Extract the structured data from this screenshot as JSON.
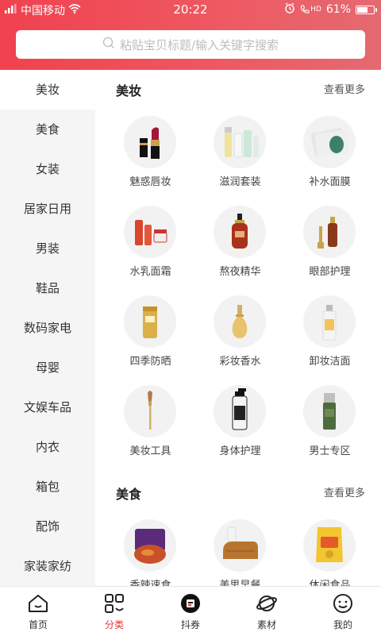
{
  "status_bar": {
    "carrier": "中国移动",
    "time": "20:22",
    "signal_text": "HD",
    "battery": "61%"
  },
  "search": {
    "placeholder": "粘贴宝贝标题/输入关键字搜索"
  },
  "sidebar": {
    "items": [
      {
        "label": "美妆"
      },
      {
        "label": "美食"
      },
      {
        "label": "女装"
      },
      {
        "label": "居家日用"
      },
      {
        "label": "男装"
      },
      {
        "label": "鞋品"
      },
      {
        "label": "数码家电"
      },
      {
        "label": "母婴"
      },
      {
        "label": "文娱车品"
      },
      {
        "label": "内衣"
      },
      {
        "label": "箱包"
      },
      {
        "label": "配饰"
      },
      {
        "label": "家装家纺"
      }
    ],
    "active_index": 0
  },
  "sections": [
    {
      "title": "美妆",
      "more": "查看更多",
      "items": [
        {
          "label": "魅惑唇妆",
          "icon": "lipstick-icon"
        },
        {
          "label": "滋润套装",
          "icon": "skincare-set-icon"
        },
        {
          "label": "补水面膜",
          "icon": "face-mask-icon"
        },
        {
          "label": "水乳面霜",
          "icon": "lotion-cream-icon"
        },
        {
          "label": "熬夜精华",
          "icon": "serum-bottle-icon"
        },
        {
          "label": "眼部护理",
          "icon": "eye-care-icon"
        },
        {
          "label": "四季防晒",
          "icon": "sunscreen-icon"
        },
        {
          "label": "彩妆香水",
          "icon": "perfume-icon"
        },
        {
          "label": "卸妆洁面",
          "icon": "cleanser-icon"
        },
        {
          "label": "美妆工具",
          "icon": "makeup-brush-icon"
        },
        {
          "label": "身体护理",
          "icon": "body-care-icon"
        },
        {
          "label": "男士专区",
          "icon": "mens-care-icon"
        }
      ]
    },
    {
      "title": "美食",
      "more": "查看更多",
      "items": [
        {
          "label": "香辣速食",
          "icon": "spicy-food-icon"
        },
        {
          "label": "美思早餐",
          "icon": "breakfast-bread-icon"
        },
        {
          "label": "休闲食品",
          "icon": "snack-bag-icon"
        }
      ]
    }
  ],
  "tabbar": {
    "tabs": [
      {
        "label": "首页",
        "icon": "home-icon"
      },
      {
        "label": "分类",
        "icon": "category-icon"
      },
      {
        "label": "抖券",
        "icon": "douyin-coupon-icon"
      },
      {
        "label": "素材",
        "icon": "planet-icon"
      },
      {
        "label": "我的",
        "icon": "profile-face-icon"
      }
    ],
    "active_index": 1
  },
  "colors": {
    "accent": "#ee3344",
    "header_start": "#f0414f",
    "header_end": "#e46a72"
  }
}
